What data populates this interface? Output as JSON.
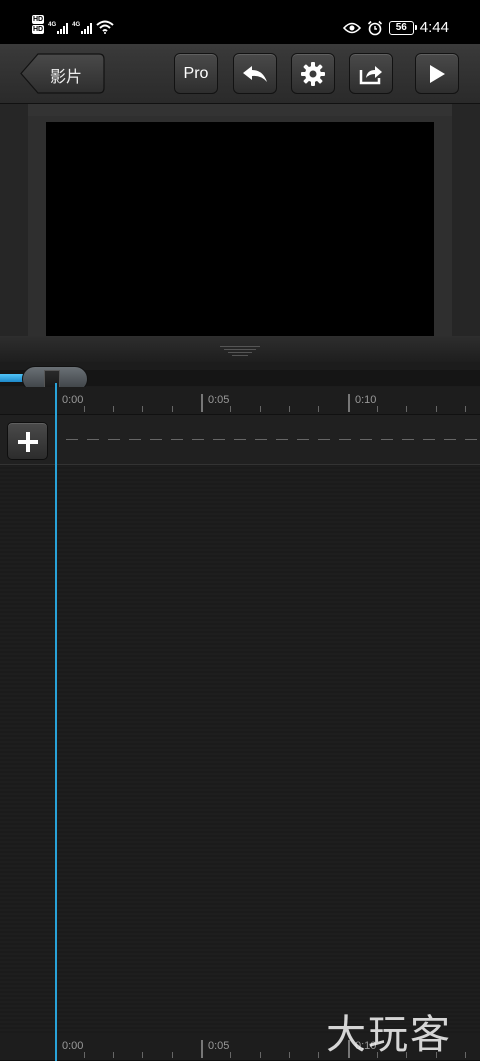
{
  "status_bar": {
    "hd1": "HD",
    "hd2": "HD",
    "net1": "4G",
    "net2": "4G",
    "battery": "56",
    "time": "4:44",
    "icons": [
      "signal-icon",
      "wifi-icon",
      "eye-icon",
      "alarm-icon",
      "battery-icon"
    ]
  },
  "toolbar": {
    "back_label": "影片",
    "pro_label": "Pro",
    "icons": [
      "undo-icon",
      "gear-icon",
      "share-icon",
      "play-icon"
    ]
  },
  "timeline": {
    "ruler_labels": [
      "0:00",
      "0:05",
      "0:10"
    ],
    "add_icon": "plus-icon",
    "scrubber_progress": 0.0
  },
  "watermark": "大玩客",
  "colors": {
    "accent": "#29a3d9",
    "background": "#1c1c1c",
    "toolbar": "#333333"
  }
}
